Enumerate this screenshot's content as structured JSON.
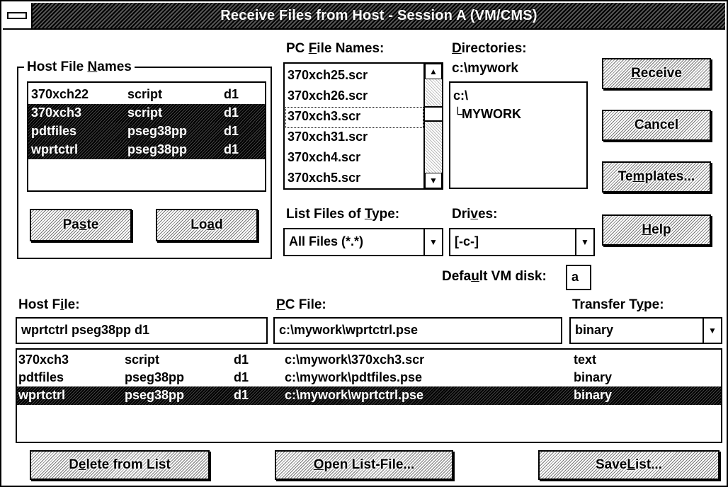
{
  "window": {
    "title": "Receive Files from Host - Session A (VM/CMS)"
  },
  "host_file_names": {
    "label_pre": "Host File ",
    "label_u": "N",
    "label_post": "ames",
    "items": [
      {
        "name": "370xch22",
        "type": "script",
        "mode": "d1",
        "selected": false
      },
      {
        "name": "370xch3",
        "type": "script",
        "mode": "d1",
        "selected": true
      },
      {
        "name": "pdtfiles",
        "type": "pseg38pp",
        "mode": "d1",
        "selected": true
      },
      {
        "name": "wprtctrl",
        "type": "pseg38pp",
        "mode": "d1",
        "selected": true
      }
    ],
    "paste_pre": "Pa",
    "paste_u": "s",
    "paste_post": "te",
    "load_pre": "Lo",
    "load_u": "a",
    "load_post": "d"
  },
  "pc_file_names": {
    "label_pre": "PC ",
    "label_u": "F",
    "label_post": "ile Names:",
    "items": [
      "370xch25.scr",
      "370xch26.scr",
      "370xch3.scr",
      "370xch31.scr",
      "370xch4.scr",
      "370xch5.scr"
    ]
  },
  "directories": {
    "label_u": "D",
    "label_post": "irectories:",
    "current": "c:\\mywork",
    "items": [
      "c:\\",
      "MYWORK"
    ]
  },
  "list_type": {
    "label_pre": "List Files of ",
    "label_u": "T",
    "label_post": "ype:",
    "value": "All Files (*.*)"
  },
  "drives": {
    "label_pre": "Dri",
    "label_u": "v",
    "label_post": "es:",
    "value": "[-c-]"
  },
  "default_disk": {
    "label_pre": "Defa",
    "label_u": "u",
    "label_post": "lt VM disk:",
    "value": "a"
  },
  "buttons": {
    "receive_u": "R",
    "receive_post": "eceive",
    "cancel": "Cancel",
    "templates_pre": "Te",
    "templates_u": "m",
    "templates_post": "plates...",
    "help_u": "H",
    "help_post": "elp",
    "delete_pre": "D",
    "delete_u": "e",
    "delete_post": "lete from List",
    "open_u": "O",
    "open_post": "pen List-File...",
    "save_pre": "Save ",
    "save_u": "L",
    "save_post": "ist..."
  },
  "host_file": {
    "label_pre": "Host F",
    "label_u": "i",
    "label_post": "le:",
    "value": "wprtctrl pseg38pp d1"
  },
  "pc_file": {
    "label_u": "P",
    "label_post": "C File:",
    "value": "c:\\mywork\\wprtctrl.pse"
  },
  "transfer_type": {
    "label_pre": "Transfer T",
    "label_u": "y",
    "label_post": "pe:",
    "value": "binary"
  },
  "transfer_list": [
    {
      "name": "370xch3",
      "type": "script",
      "mode": "d1",
      "pc": "c:\\mywork\\370xch3.scr",
      "xfer": "text",
      "selected": false
    },
    {
      "name": "pdtfiles",
      "type": "pseg38pp",
      "mode": "d1",
      "pc": "c:\\mywork\\pdtfiles.pse",
      "xfer": "binary",
      "selected": false
    },
    {
      "name": "wprtctrl",
      "type": "pseg38pp",
      "mode": "d1",
      "pc": "c:\\mywork\\wprtctrl.pse",
      "xfer": "binary",
      "selected": true
    }
  ]
}
